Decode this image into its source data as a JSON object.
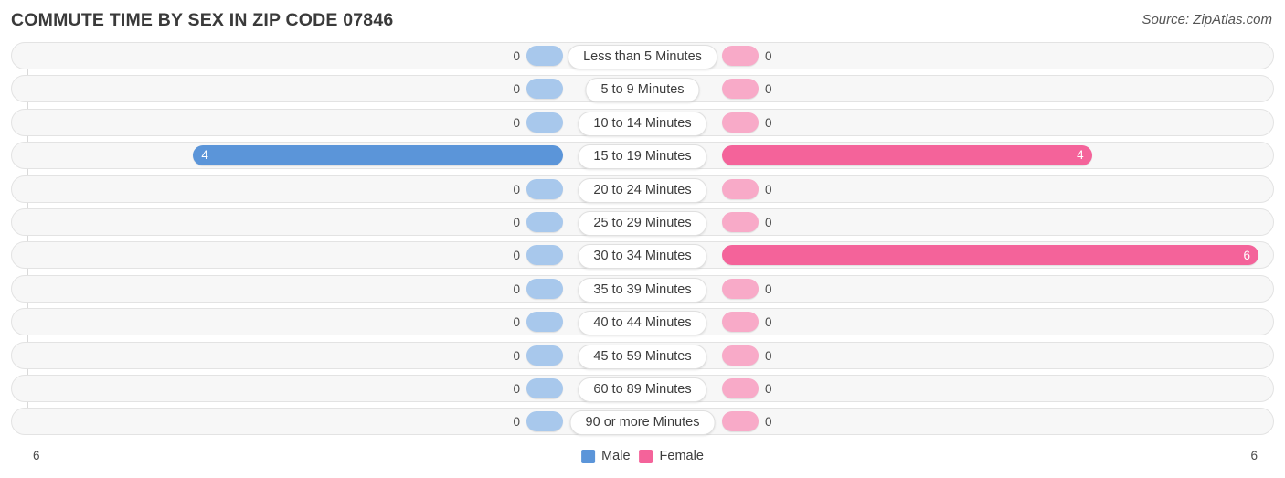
{
  "header": {
    "title": "COMMUTE TIME BY SEX IN ZIP CODE 07846",
    "source": "Source: ZipAtlas.com"
  },
  "legend": {
    "male_label": "Male",
    "female_label": "Female",
    "male_color": "#5b95d9",
    "female_color": "#f4639a"
  },
  "axis": {
    "min_label": "6",
    "max_label": "6"
  },
  "colors": {
    "male_strong": "#5b95d9",
    "male_light": "#a8c8ec",
    "female_strong": "#f4639a",
    "female_light": "#f8aac8",
    "row_track": "#f7f7f7",
    "row_border": "#e3e3e3"
  },
  "chart_data": {
    "type": "bar",
    "orientation": "horizontal-diverging",
    "title": "COMMUTE TIME BY SEX IN ZIP CODE 07846",
    "xlabel": "",
    "ylabel": "",
    "xlim": [
      6,
      6
    ],
    "grid": true,
    "legend_position": "bottom-center",
    "categories": [
      "Less than 5 Minutes",
      "5 to 9 Minutes",
      "10 to 14 Minutes",
      "15 to 19 Minutes",
      "20 to 24 Minutes",
      "25 to 29 Minutes",
      "30 to 34 Minutes",
      "35 to 39 Minutes",
      "40 to 44 Minutes",
      "45 to 59 Minutes",
      "60 to 89 Minutes",
      "90 or more Minutes"
    ],
    "series": [
      {
        "name": "Male",
        "values": [
          0,
          0,
          0,
          4,
          0,
          0,
          0,
          0,
          0,
          0,
          0,
          0
        ]
      },
      {
        "name": "Female",
        "values": [
          0,
          0,
          0,
          4,
          0,
          0,
          6,
          0,
          0,
          0,
          0,
          0
        ]
      }
    ]
  },
  "rows": [
    {
      "label": "Less than 5 Minutes",
      "male": "0",
      "female": "0"
    },
    {
      "label": "5 to 9 Minutes",
      "male": "0",
      "female": "0"
    },
    {
      "label": "10 to 14 Minutes",
      "male": "0",
      "female": "0"
    },
    {
      "label": "15 to 19 Minutes",
      "male": "4",
      "female": "4"
    },
    {
      "label": "20 to 24 Minutes",
      "male": "0",
      "female": "0"
    },
    {
      "label": "25 to 29 Minutes",
      "male": "0",
      "female": "0"
    },
    {
      "label": "30 to 34 Minutes",
      "male": "0",
      "female": "6"
    },
    {
      "label": "35 to 39 Minutes",
      "male": "0",
      "female": "0"
    },
    {
      "label": "40 to 44 Minutes",
      "male": "0",
      "female": "0"
    },
    {
      "label": "45 to 59 Minutes",
      "male": "0",
      "female": "0"
    },
    {
      "label": "60 to 89 Minutes",
      "male": "0",
      "female": "0"
    },
    {
      "label": "90 or more Minutes",
      "male": "0",
      "female": "0"
    }
  ]
}
